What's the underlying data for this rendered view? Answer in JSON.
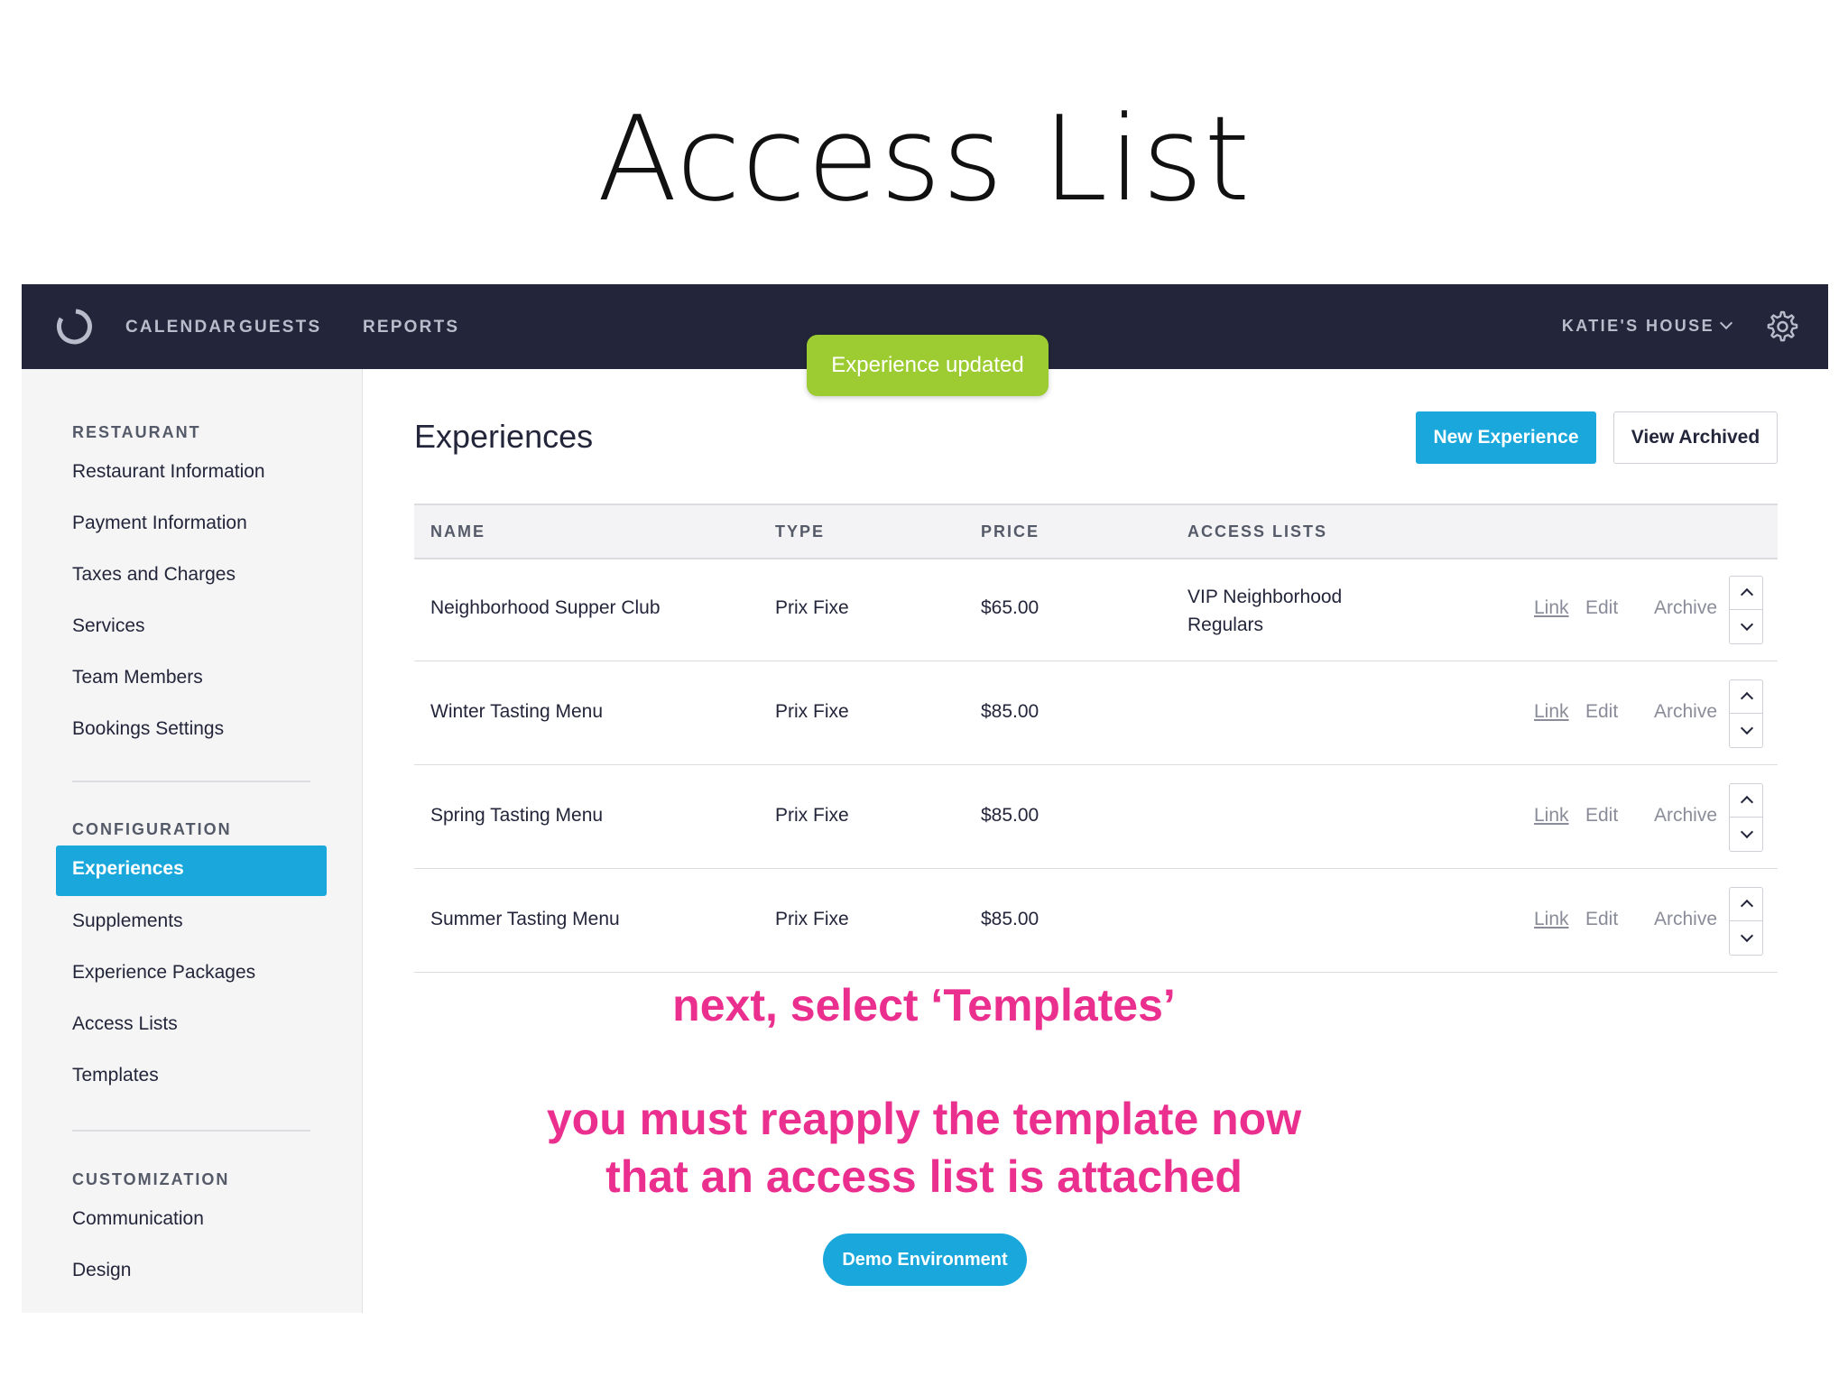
{
  "slide": {
    "title": "Access List",
    "annotation_1": "next, select ‘Templates’",
    "annotation_2_line_1": "you must reapply the template now",
    "annotation_2_line_2": "that an access list is attached",
    "annotation_color": "#ea2f8f"
  },
  "topbar": {
    "logo_icon": "ring-logo-icon",
    "nav": [
      "CALENDAR",
      "GUESTS",
      "REPORTS"
    ],
    "venue": "KATIE'S HOUSE",
    "settings_icon": "gear-icon"
  },
  "toast": {
    "message": "Experience updated",
    "color": "#9ccc32"
  },
  "sidebar": {
    "sections": [
      {
        "heading": "RESTAURANT",
        "items": [
          "Restaurant Information",
          "Payment Information",
          "Taxes and Charges",
          "Services",
          "Team Members",
          "Bookings Settings"
        ]
      },
      {
        "heading": "CONFIGURATION",
        "items": [
          "Experiences",
          "Supplements",
          "Experience Packages",
          "Access Lists",
          "Templates"
        ]
      },
      {
        "heading": "CUSTOMIZATION",
        "items": [
          "Communication",
          "Design"
        ]
      }
    ],
    "active_item": "Experiences"
  },
  "main": {
    "title": "Experiences",
    "new_button": "New Experience",
    "archived_button": "View Archived",
    "columns": [
      "NAME",
      "TYPE",
      "PRICE",
      "ACCESS LISTS"
    ],
    "row_actions": [
      "Link",
      "Edit",
      "Archive"
    ],
    "rows": [
      {
        "name": "Neighborhood Supper Club",
        "type": "Prix Fixe",
        "price": "$65.00",
        "access_lists": "VIP Neighborhood Regulars"
      },
      {
        "name": "Winter Tasting Menu",
        "type": "Prix Fixe",
        "price": "$85.00",
        "access_lists": ""
      },
      {
        "name": "Spring Tasting Menu",
        "type": "Prix Fixe",
        "price": "$85.00",
        "access_lists": ""
      },
      {
        "name": "Summer Tasting Menu",
        "type": "Prix Fixe",
        "price": "$85.00",
        "access_lists": ""
      }
    ]
  },
  "footer": {
    "demo_badge": "Demo Environment"
  },
  "colors": {
    "accent": "#1aa7dc",
    "topbar": "#23263a"
  }
}
